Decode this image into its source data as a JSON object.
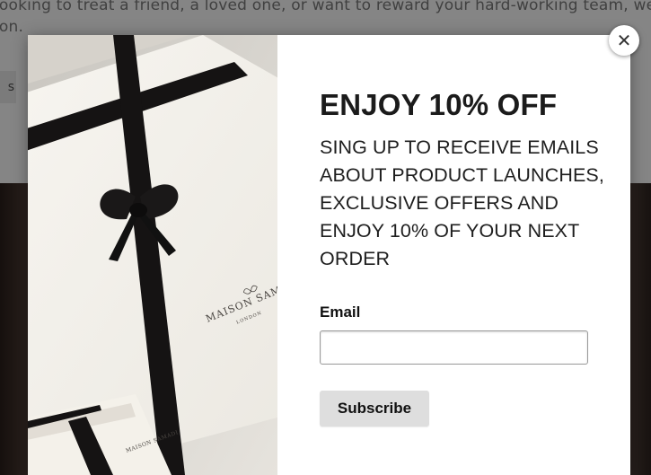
{
  "background": {
    "intro_line_1": "looking to treat a friend, a loved one, or want to reward your hard-working team, we h",
    "intro_line_2": "ion.",
    "button_fragment": "s"
  },
  "popup": {
    "brand_on_box": "MAISON SAMADI",
    "brand_subtitle": "LONDON",
    "brand_on_small_box": "MAISON SAMADI",
    "headline": "ENJOY 10% OFF",
    "body": "SING UP TO RECEIVE EMAILS ABOUT PRODUCT LAUNCHES, EXCLUSIVE OFFERS AND ENJOY 10% OF YOUR NEXT ORDER",
    "email_label": "Email",
    "email_value": "",
    "email_placeholder": "",
    "subscribe_label": "Subscribe",
    "close_icon": "close-icon",
    "close_glyph": "✕"
  },
  "colors": {
    "overlay": "rgba(0,0,0,0.48)",
    "ribbon": "#141212",
    "box": "#f6f4ef"
  }
}
